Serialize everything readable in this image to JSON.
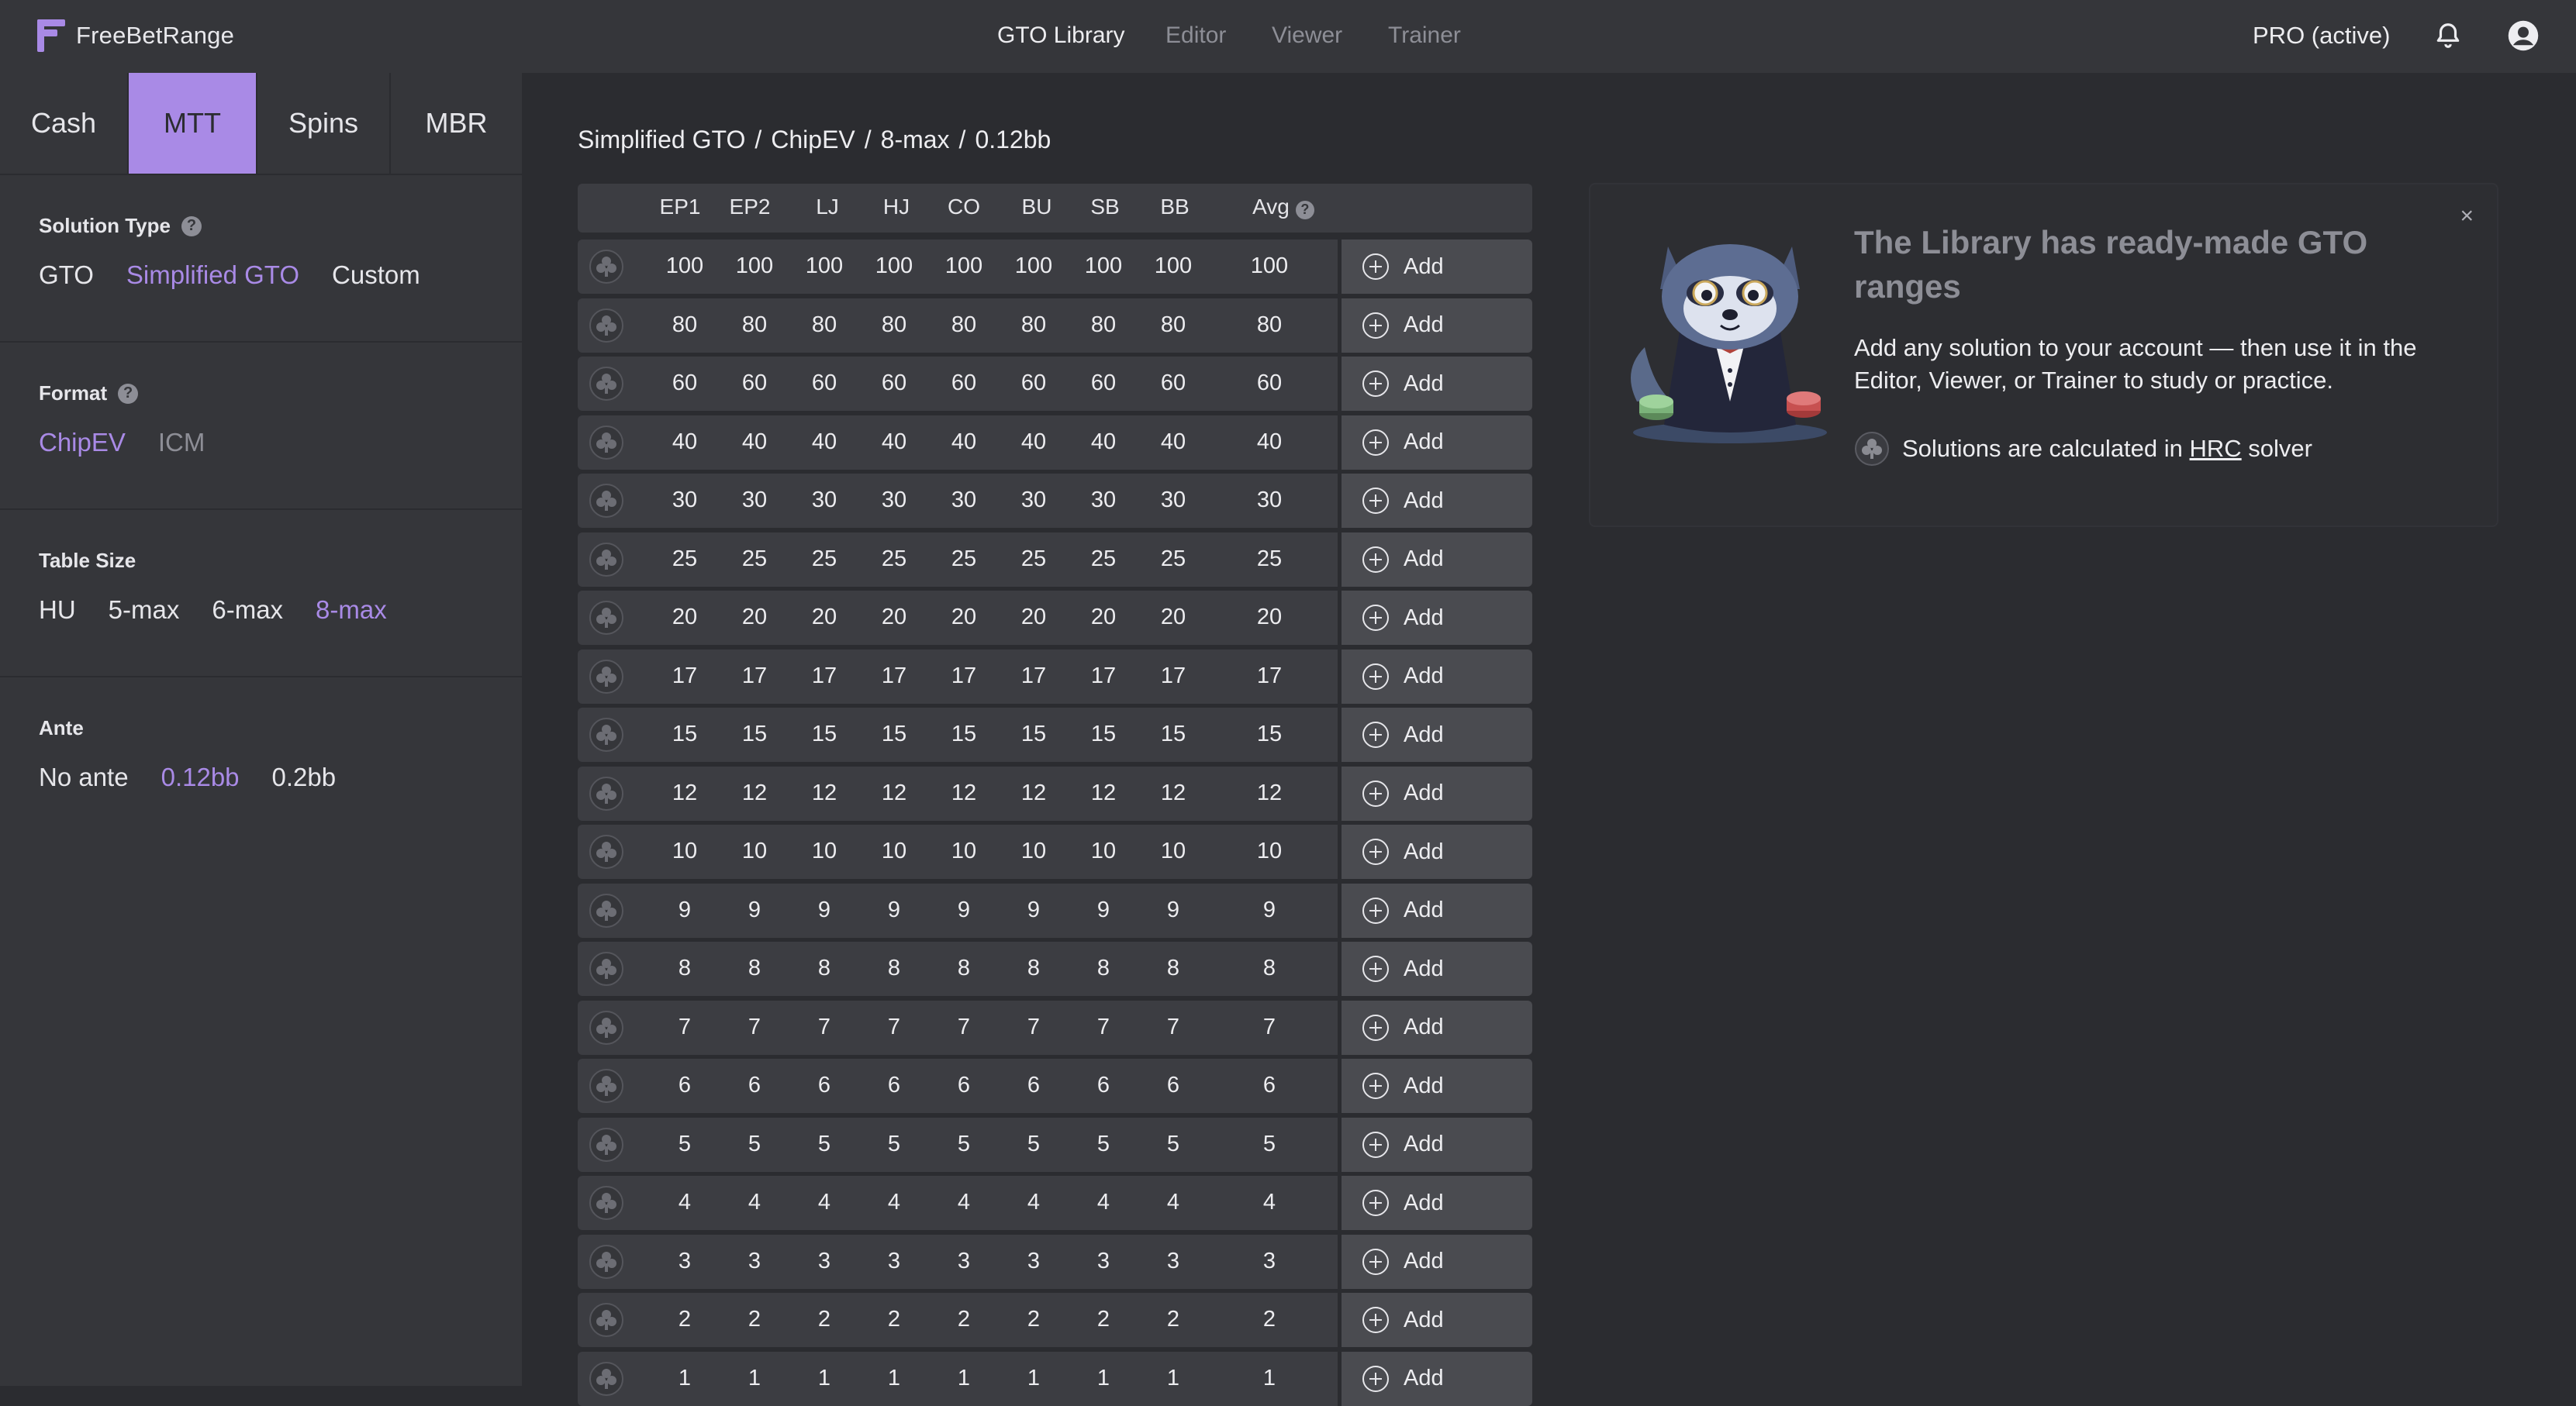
{
  "app": {
    "name": "FreeBetRange"
  },
  "nav": {
    "items": [
      {
        "label": "GTO Library",
        "active": true
      },
      {
        "label": "Editor",
        "active": false
      },
      {
        "label": "Viewer",
        "active": false
      },
      {
        "label": "Trainer",
        "active": false
      }
    ],
    "account_status": "PRO (active)",
    "icons": [
      "bell-icon",
      "user-icon"
    ]
  },
  "sidebar": {
    "tabs": [
      {
        "label": "Cash",
        "active": false
      },
      {
        "label": "MTT",
        "active": true
      },
      {
        "label": "Spins",
        "active": false
      },
      {
        "label": "MBR",
        "active": false
      }
    ],
    "solution_type": {
      "title": "Solution Type",
      "help": "?",
      "options": [
        "GTO",
        "Simplified GTO",
        "Custom"
      ],
      "selected": "Simplified GTO"
    },
    "format": {
      "title": "Format",
      "help": "?",
      "options": [
        "ChipEV",
        "ICM"
      ],
      "selected": "ChipEV"
    },
    "table_size": {
      "title": "Table Size",
      "options": [
        "HU",
        "5-max",
        "6-max",
        "8-max"
      ],
      "selected": "8-max"
    },
    "ante": {
      "title": "Ante",
      "options": [
        "No ante",
        "0.12bb",
        "0.2bb"
      ],
      "selected": "0.12bb"
    }
  },
  "breadcrumb": {
    "items": [
      "Simplified GTO",
      "ChipEV",
      "8-max",
      "0.12bb"
    ],
    "separator": "/"
  },
  "table": {
    "columns": [
      "EP1",
      "EP2",
      "LJ",
      "HJ",
      "CO",
      "BU",
      "SB",
      "BB",
      "Avg"
    ],
    "avg_help": "?",
    "add_label": "Add",
    "rows": [
      [
        "100",
        "100",
        "100",
        "100",
        "100",
        "100",
        "100",
        "100",
        "100"
      ],
      [
        "80",
        "80",
        "80",
        "80",
        "80",
        "80",
        "80",
        "80",
        "80"
      ],
      [
        "60",
        "60",
        "60",
        "60",
        "60",
        "60",
        "60",
        "60",
        "60"
      ],
      [
        "40",
        "40",
        "40",
        "40",
        "40",
        "40",
        "40",
        "40",
        "40"
      ],
      [
        "30",
        "30",
        "30",
        "30",
        "30",
        "30",
        "30",
        "30",
        "30"
      ],
      [
        "25",
        "25",
        "25",
        "25",
        "25",
        "25",
        "25",
        "25",
        "25"
      ],
      [
        "20",
        "20",
        "20",
        "20",
        "20",
        "20",
        "20",
        "20",
        "20"
      ],
      [
        "17",
        "17",
        "17",
        "17",
        "17",
        "17",
        "17",
        "17",
        "17"
      ],
      [
        "15",
        "15",
        "15",
        "15",
        "15",
        "15",
        "15",
        "15",
        "15"
      ],
      [
        "12",
        "12",
        "12",
        "12",
        "12",
        "12",
        "12",
        "12",
        "12"
      ],
      [
        "10",
        "10",
        "10",
        "10",
        "10",
        "10",
        "10",
        "10",
        "10"
      ],
      [
        "9",
        "9",
        "9",
        "9",
        "9",
        "9",
        "9",
        "9",
        "9"
      ],
      [
        "8",
        "8",
        "8",
        "8",
        "8",
        "8",
        "8",
        "8",
        "8"
      ],
      [
        "7",
        "7",
        "7",
        "7",
        "7",
        "7",
        "7",
        "7",
        "7"
      ],
      [
        "6",
        "6",
        "6",
        "6",
        "6",
        "6",
        "6",
        "6",
        "6"
      ],
      [
        "5",
        "5",
        "5",
        "5",
        "5",
        "5",
        "5",
        "5",
        "5"
      ],
      [
        "4",
        "4",
        "4",
        "4",
        "4",
        "4",
        "4",
        "4",
        "4"
      ],
      [
        "3",
        "3",
        "3",
        "3",
        "3",
        "3",
        "3",
        "3",
        "3"
      ],
      [
        "2",
        "2",
        "2",
        "2",
        "2",
        "2",
        "2",
        "2",
        "2"
      ],
      [
        "1",
        "1",
        "1",
        "1",
        "1",
        "1",
        "1",
        "1",
        "1"
      ]
    ]
  },
  "info_panel": {
    "close": "×",
    "title": "The Library has ready-made GTO ranges",
    "body": "Add any solution to your account — then use it in the Editor, Viewer, or Trainer to study or practice.",
    "footer_prefix": "Solutions are calculated in ",
    "footer_link": "HRC",
    "footer_suffix": " solver"
  },
  "colors": {
    "accent": "#a98ae6",
    "background": "#2b2c30",
    "panel": "#35363a",
    "row": "#3c3d42",
    "add_button": "#4a4b50"
  }
}
